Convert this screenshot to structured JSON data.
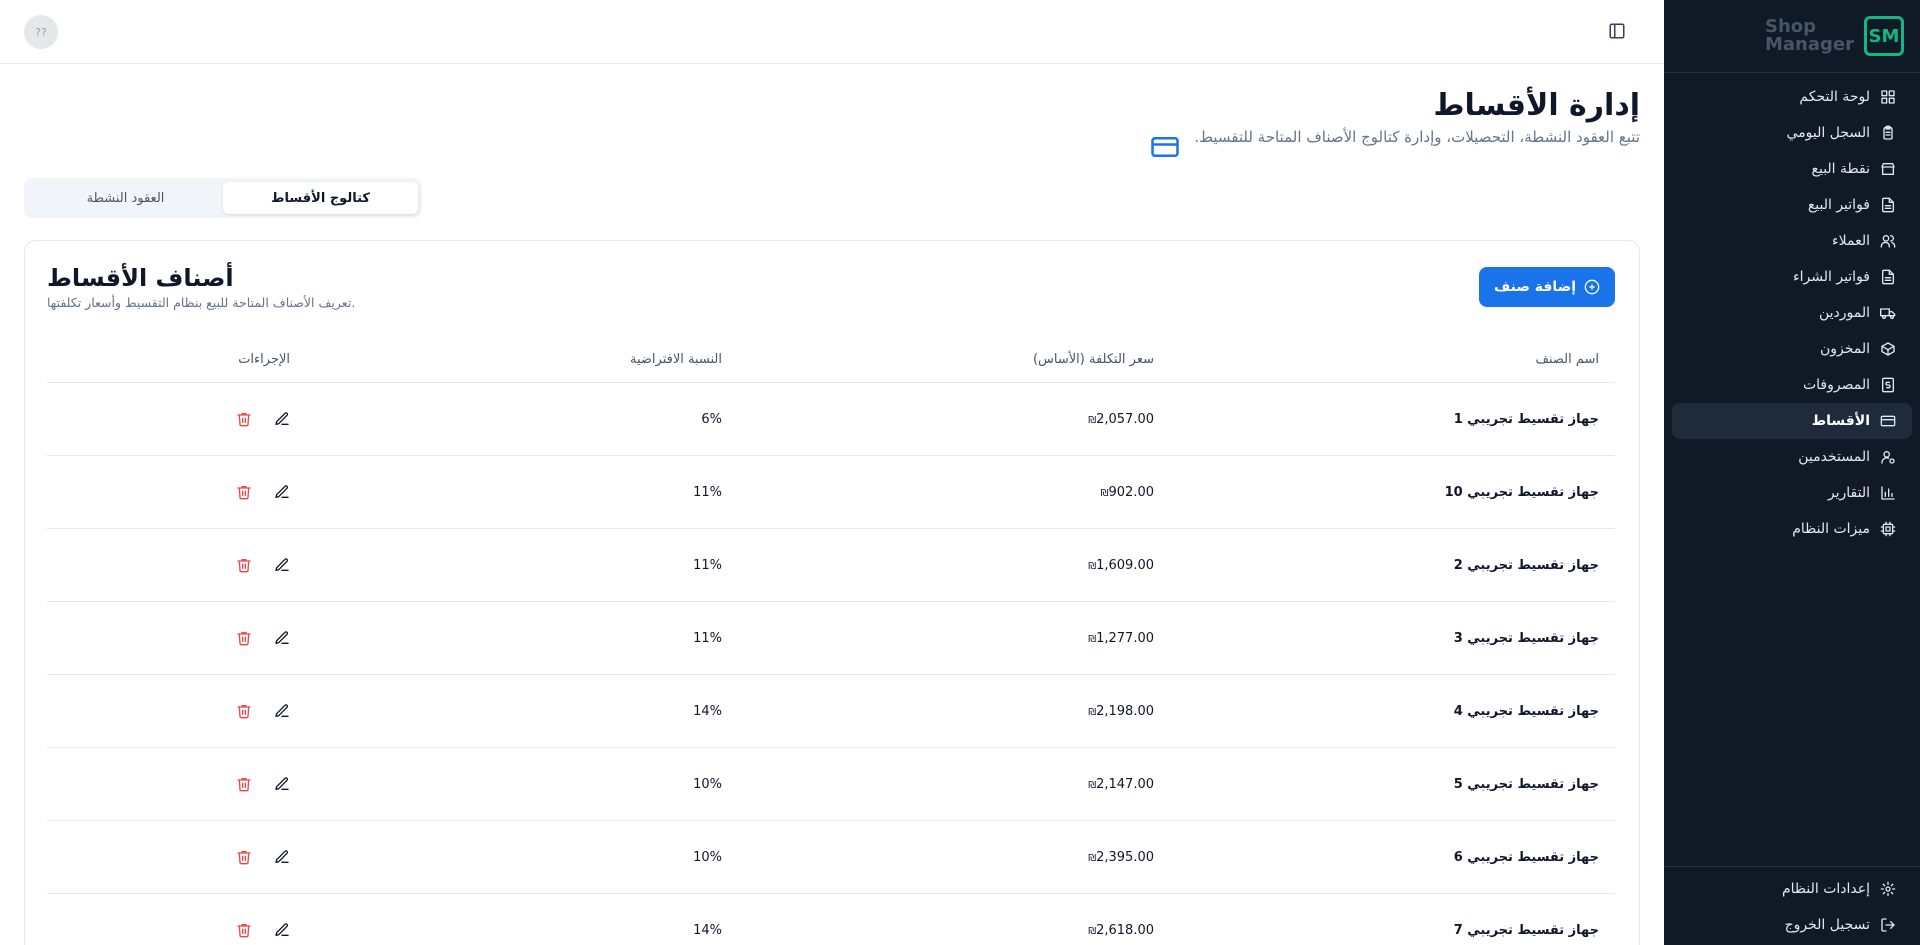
{
  "app": {
    "logo_mark": "SM",
    "logo_line1": "Shop",
    "logo_line2": "Manager",
    "avatar_text": "??"
  },
  "sidebar": {
    "items": [
      {
        "label": "لوحة التحكم",
        "icon": "grid-icon"
      },
      {
        "label": "السجل اليومي",
        "icon": "clipboard-icon"
      },
      {
        "label": "نقطة البيع",
        "icon": "store-icon"
      },
      {
        "label": "فواتير البيع",
        "icon": "file-icon"
      },
      {
        "label": "العملاء",
        "icon": "users-icon"
      },
      {
        "label": "فواتير الشراء",
        "icon": "file-icon"
      },
      {
        "label": "الموردين",
        "icon": "truck-icon"
      },
      {
        "label": "المخزون",
        "icon": "package-icon"
      },
      {
        "label": "المصروفات",
        "icon": "receipt-icon"
      },
      {
        "label": "الأقساط",
        "icon": "credit-card-icon",
        "active": true
      },
      {
        "label": "المستخدمين",
        "icon": "user-cog-icon"
      },
      {
        "label": "التقارير",
        "icon": "bar-chart-icon"
      },
      {
        "label": "ميزات النظام",
        "icon": "cpu-icon"
      }
    ],
    "bottom": [
      {
        "label": "إعدادات النظام",
        "icon": "gear-icon"
      },
      {
        "label": "تسجيل الخروج",
        "icon": "logout-icon"
      }
    ]
  },
  "page": {
    "title": "إدارة الأقساط",
    "subtitle": "تتبع العقود النشطة، التحصيلات، وإدارة كتالوج الأصناف المتاحة للتقسيط."
  },
  "tabs": [
    {
      "label": "كتالوج الأقساط",
      "active": true
    },
    {
      "label": "العقود النشطة",
      "active": false
    }
  ],
  "card": {
    "title": "أصناف الأقساط",
    "subtitle": ".تعريف الأصناف المتاحة للبيع بنظام التقسيط وأسعار تكلفتها",
    "add_button": "إضافة صنف"
  },
  "table": {
    "headers": {
      "name": "اسم الصنف",
      "cost": "سعر التكلفة (الأساس)",
      "pct": "النسبة الافتراضية",
      "actions": "الإجراءات"
    },
    "currency_symbol": "₪",
    "rows": [
      {
        "name": "جهاز تقسيط تجريبي 1",
        "cost": "2,057.00",
        "pct": "6%"
      },
      {
        "name": "جهاز تقسيط تجريبي 10",
        "cost": "902.00",
        "pct": "11%"
      },
      {
        "name": "جهاز تقسيط تجريبي 2",
        "cost": "1,609.00",
        "pct": "11%"
      },
      {
        "name": "جهاز تقسيط تجريبي 3",
        "cost": "1,277.00",
        "pct": "11%"
      },
      {
        "name": "جهاز تقسيط تجريبي 4",
        "cost": "2,198.00",
        "pct": "14%"
      },
      {
        "name": "جهاز تقسيط تجريبي 5",
        "cost": "2,147.00",
        "pct": "10%"
      },
      {
        "name": "جهاز تقسيط تجريبي 6",
        "cost": "2,395.00",
        "pct": "10%"
      },
      {
        "name": "جهاز تقسيط تجريبي 7",
        "cost": "2,618.00",
        "pct": "14%"
      }
    ]
  },
  "colors": {
    "sidebar_bg": "#101a26",
    "accent": "#1a73e8",
    "danger": "#ef4444",
    "brand": "#10b981"
  }
}
